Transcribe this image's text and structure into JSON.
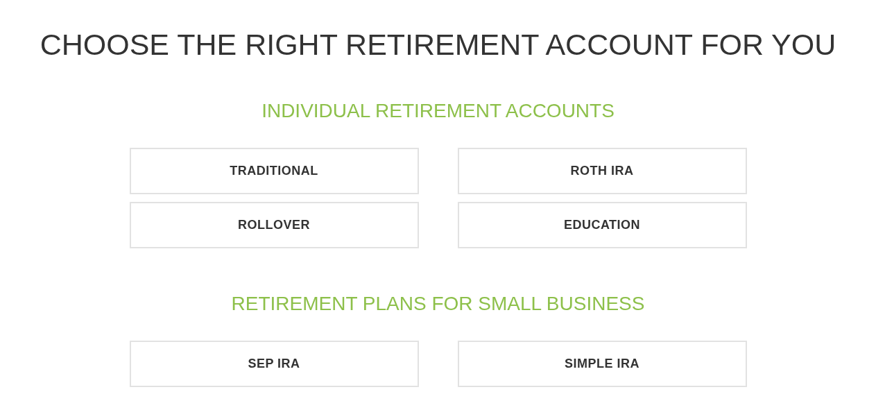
{
  "title": "CHOOSE THE RIGHT RETIREMENT ACCOUNT FOR YOU",
  "sections": [
    {
      "heading": "INDIVIDUAL RETIREMENT ACCOUNTS",
      "buttons": [
        "TRADITIONAL",
        "ROTH IRA",
        "ROLLOVER",
        "EDUCATION"
      ]
    },
    {
      "heading": "RETIREMENT PLANS FOR SMALL BUSINESS",
      "buttons": [
        "SEP IRA",
        "SIMPLE IRA"
      ]
    }
  ]
}
